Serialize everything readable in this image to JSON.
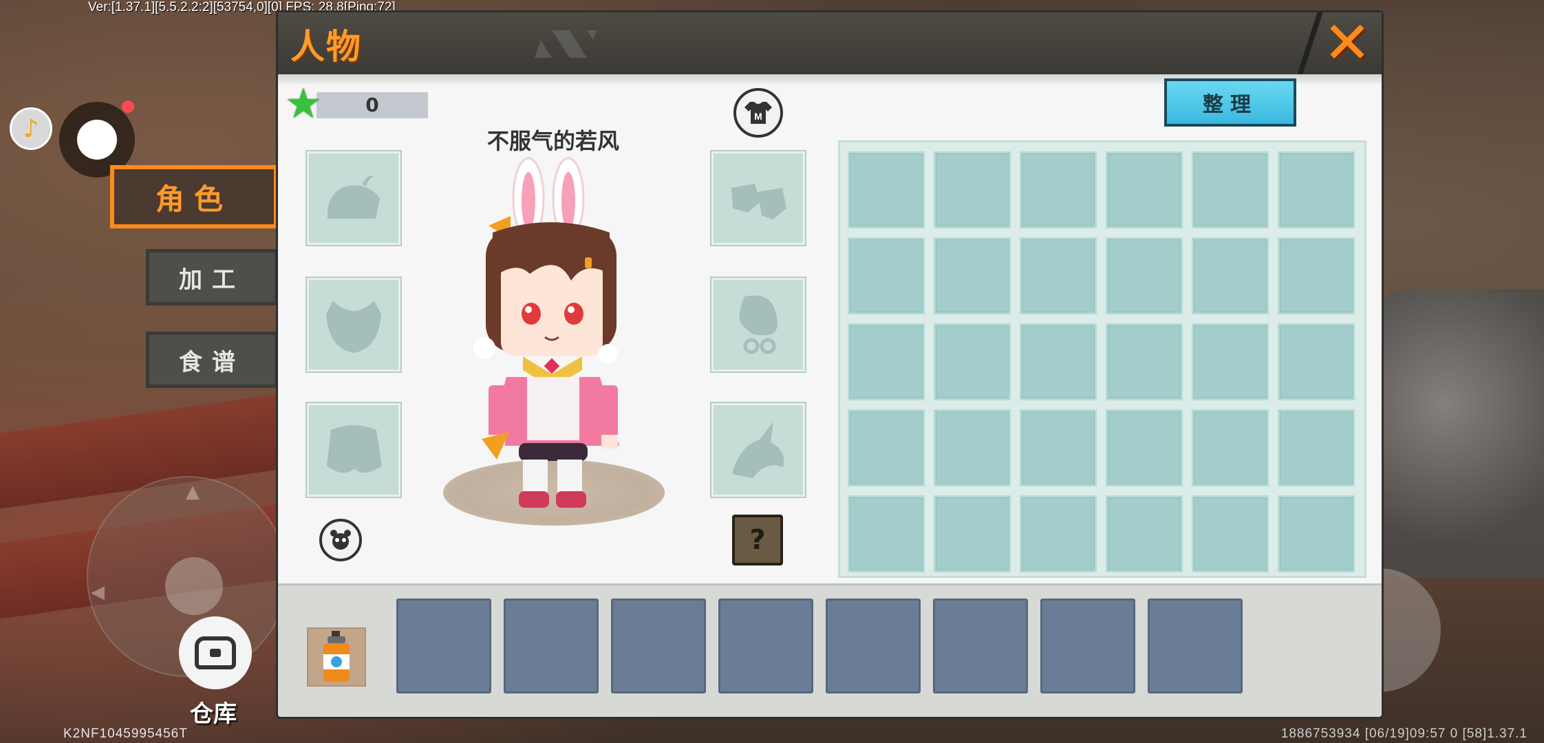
{
  "debug": {
    "version_line": "Ver:[1.37.1][5.5.2.2:2][53754,0][0] FPS: 28.8[Ping:72]",
    "device_id": "K2NF1045995456T",
    "bottom_status": "1886753934   [06/19]09:57 0   [58]1.37.1"
  },
  "hud": {
    "music_icon": "music-note-icon",
    "storage_label": "仓库",
    "side_tabs": [
      {
        "label": "角色",
        "active": true
      },
      {
        "label": "加工",
        "active": false
      },
      {
        "label": "食谱",
        "active": false
      }
    ]
  },
  "panel": {
    "title": "人物",
    "close_icon": "close-x-icon",
    "star_count": "0",
    "character_name": "不服气的若风",
    "sort_button": "整理",
    "wardrobe_icon": "m-shirt-icon",
    "help_icon": "question-mark-icon",
    "left_slots": [
      "helmet-slot",
      "chest-armor-slot",
      "cape-slot"
    ],
    "right_slots": [
      "boots-slot",
      "accessory-slot",
      "mount-slot"
    ],
    "bag_rows": 5,
    "bag_cols": 6,
    "hotbar_item": "spray-can-item",
    "hotbar_slots": 8
  },
  "colors": {
    "accent_orange": "#ff8a1a",
    "bag_cell": "#a2cdcb",
    "hotbar_slot": "#6b7d96",
    "sort_button": "#3ab8e0"
  }
}
